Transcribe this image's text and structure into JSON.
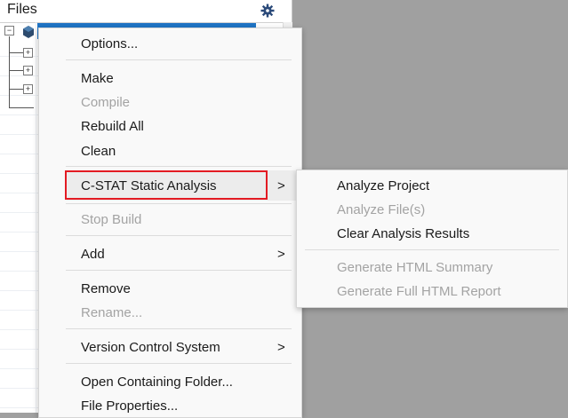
{
  "files_panel": {
    "title": "Files"
  },
  "context_menu": {
    "options": "Options...",
    "make": "Make",
    "compile": "Compile",
    "rebuild_all": "Rebuild All",
    "clean": "Clean",
    "cstat": "C-STAT Static Analysis",
    "stop_build": "Stop Build",
    "add": "Add",
    "remove": "Remove",
    "rename": "Rename...",
    "version_control": "Version Control System",
    "open_folder": "Open Containing Folder...",
    "file_properties": "File Properties...",
    "submenu_arrow": ">"
  },
  "cstat_submenu": {
    "analyze_project": "Analyze Project",
    "analyze_files": "Analyze File(s)",
    "clear_results": "Clear Analysis Results",
    "html_summary": "Generate HTML Summary",
    "html_report": "Generate Full HTML Report"
  },
  "colors": {
    "highlight_border": "#e31b23",
    "selection": "#1f74c5",
    "gear_icon": "#2b4a7a"
  },
  "icons": {
    "gear": "gear-icon",
    "project": "project-cube-icon",
    "expand": "expand-plus-icon",
    "collapse": "collapse-minus-icon"
  }
}
